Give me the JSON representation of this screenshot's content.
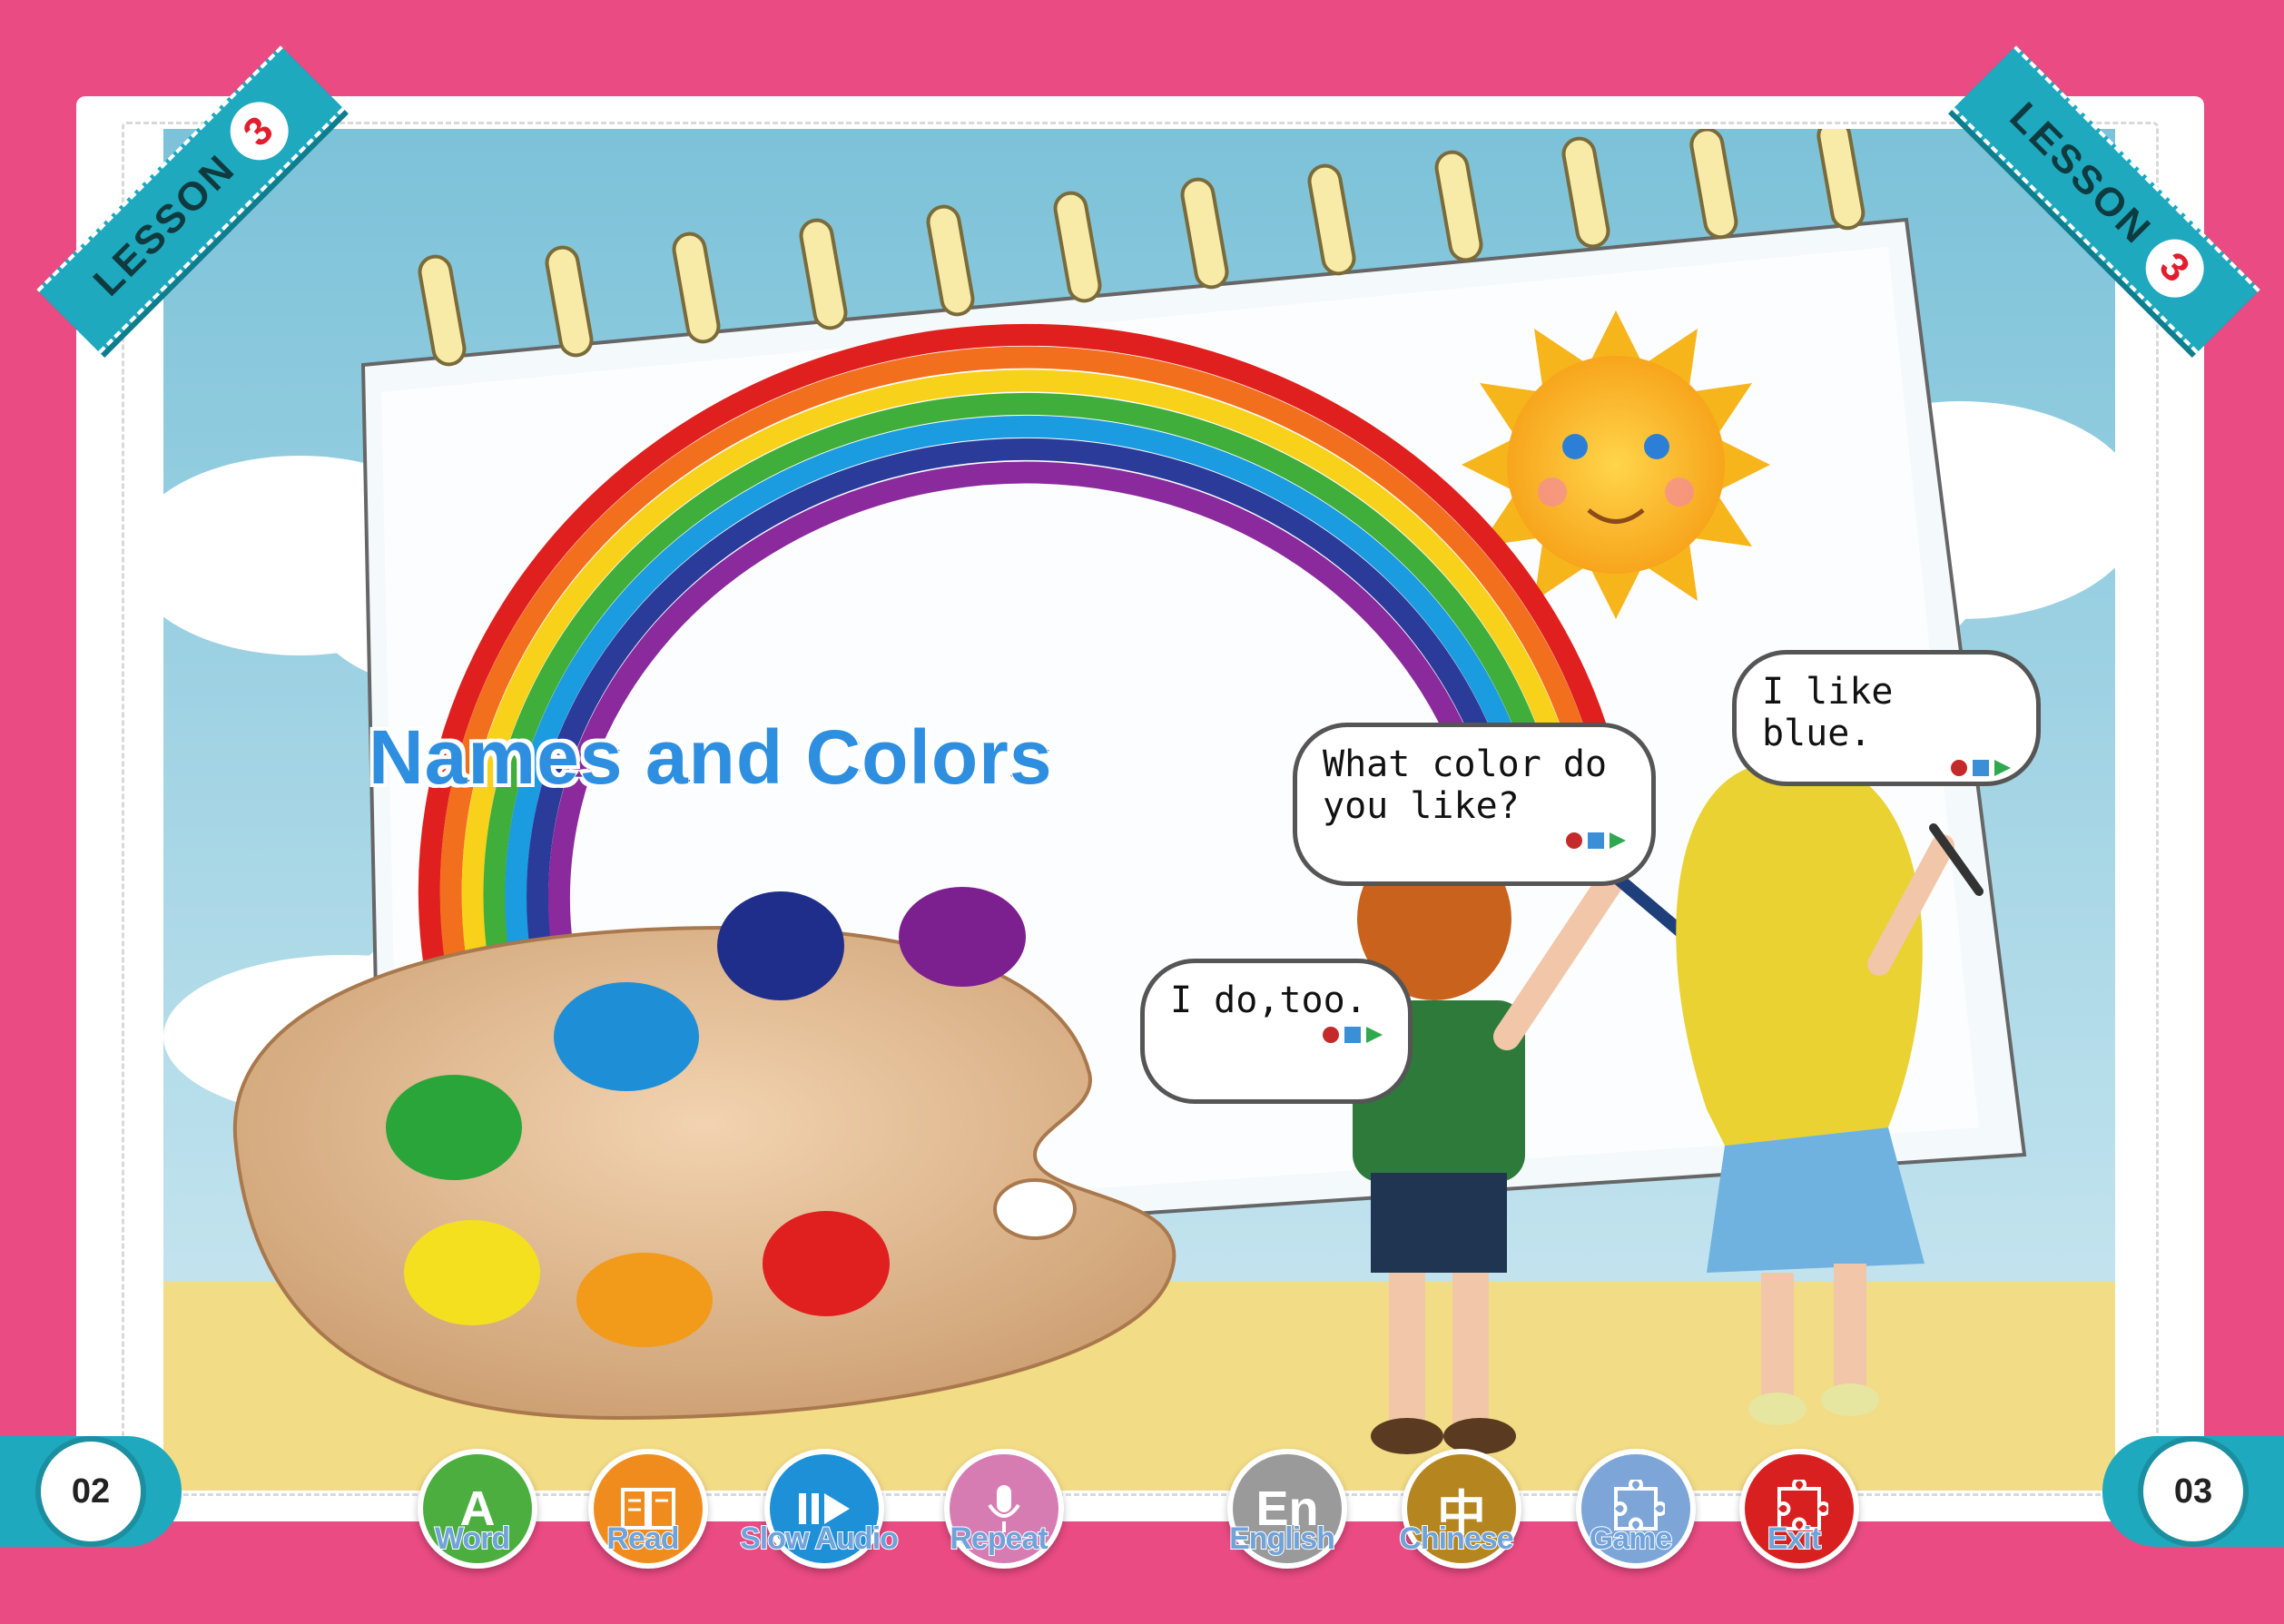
{
  "lesson": {
    "label": "LESSON",
    "number": "3"
  },
  "title": "Names and Colors",
  "bubbles": {
    "question": "What color do you like?",
    "answer_blue": "I like blue.",
    "answer_too": "I do,too."
  },
  "pages": {
    "left": "02",
    "right": "03"
  },
  "toolbar": [
    {
      "label": "Word",
      "color": "#4cae3f",
      "icon": "A"
    },
    {
      "label": "Read",
      "color": "#f08c1e",
      "icon": "book-icon"
    },
    {
      "label": "Slow Audio",
      "color": "#1e90d8",
      "icon": "slow-play-icon"
    },
    {
      "label": "Repeat",
      "color": "#d77cb3",
      "icon": "mic-icon"
    },
    {
      "label": "English",
      "color": "#9a9a9a",
      "icon": "En"
    },
    {
      "label": "Chinese",
      "color": "#b58620",
      "icon": "中"
    },
    {
      "label": "Game",
      "color": "#7da5d8",
      "icon": "puzzle-icon"
    },
    {
      "label": "Exit",
      "color": "#d92020",
      "icon": "puzzle-icon"
    }
  ],
  "colors": {
    "frame": "#e94b82",
    "accent": "#1ea9be"
  }
}
